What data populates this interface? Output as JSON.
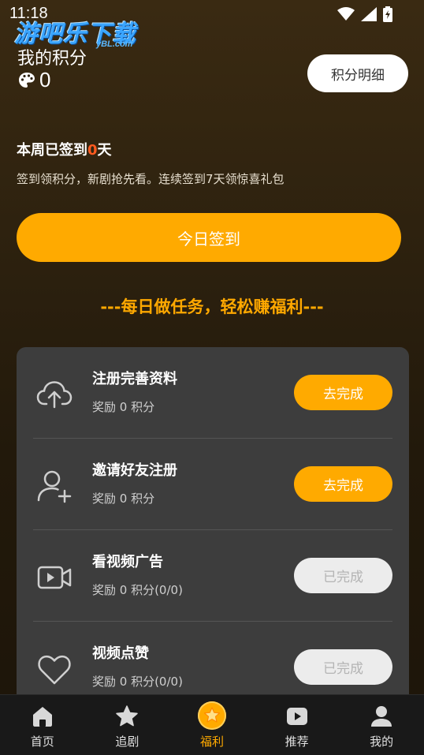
{
  "status_bar": {
    "time": "11:18"
  },
  "watermark": {
    "main": "游吧乐下载",
    "sub": "yBL.com"
  },
  "points": {
    "title": "我的积分",
    "value": "0",
    "detail_button": "积分明细"
  },
  "week": {
    "prefix": "本周已签到",
    "count": "0",
    "suffix": "天",
    "description": "签到领积分，新剧抢先看。连续签到7天领惊喜礼包"
  },
  "checkin_button": "今日签到",
  "daily_heading": "---每日做任务，轻松赚福利---",
  "tasks": [
    {
      "name": "注册完善资料",
      "reward": "奖励 0 积分",
      "button": "去完成",
      "icon": "cloud-upload-icon",
      "state": "active"
    },
    {
      "name": "邀请好友注册",
      "reward": "奖励 0 积分",
      "button": "去完成",
      "icon": "add-user-icon",
      "state": "active"
    },
    {
      "name": "看视频广告",
      "reward": "奖励 0 积分(0/0)",
      "button": "已完成",
      "icon": "video-icon",
      "state": "done"
    },
    {
      "name": "视频点赞",
      "reward": "奖励 0 积分(0/0)",
      "button": "已完成",
      "icon": "heart-icon",
      "state": "done"
    }
  ],
  "bottom_nav": [
    {
      "label": "首页",
      "icon": "home-icon"
    },
    {
      "label": "追剧",
      "icon": "star-icon"
    },
    {
      "label": "福利",
      "icon": "welfare-star-icon",
      "active": true
    },
    {
      "label": "推荐",
      "icon": "play-icon"
    },
    {
      "label": "我的",
      "icon": "profile-icon"
    }
  ],
  "colors": {
    "accent": "#ffaa00",
    "highlight": "#ff5a1f",
    "card": "#3d3d3d",
    "nav_bg": "#191919"
  }
}
